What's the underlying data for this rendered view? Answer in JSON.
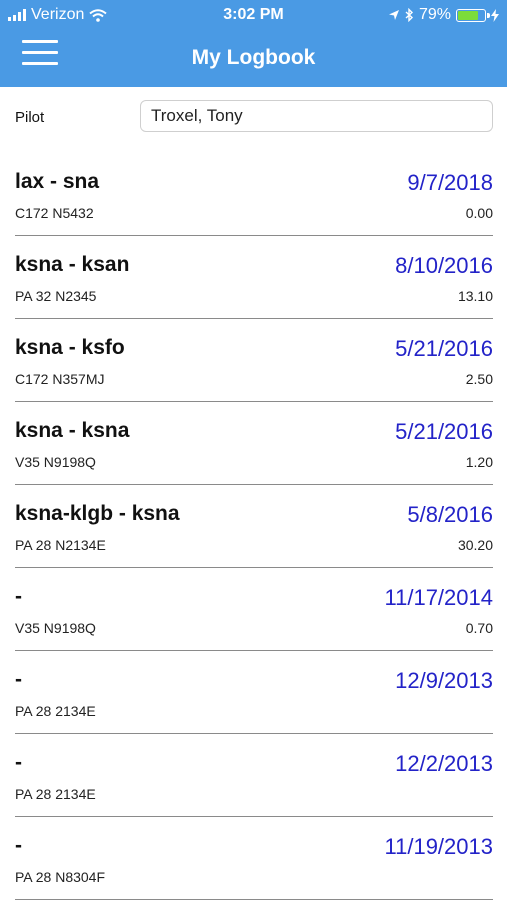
{
  "status_bar": {
    "carrier": "Verizon",
    "time": "3:02 PM",
    "battery": "79%",
    "battery_level": 0.79
  },
  "header": {
    "title": "My Logbook"
  },
  "pilot": {
    "label": "Pilot",
    "value": "Troxel, Tony"
  },
  "entries": [
    {
      "route": "lax - sna",
      "date": "9/7/2018",
      "aircraft": "C172 N5432",
      "hours": "0.00"
    },
    {
      "route": "ksna - ksan",
      "date": "8/10/2016",
      "aircraft": "PA 32 N2345",
      "hours": "13.10"
    },
    {
      "route": "ksna - ksfo",
      "date": "5/21/2016",
      "aircraft": "C172 N357MJ",
      "hours": "2.50"
    },
    {
      "route": "ksna - ksna",
      "date": "5/21/2016",
      "aircraft": "V35 N9198Q",
      "hours": "1.20"
    },
    {
      "route": "ksna-klgb - ksna",
      "date": "5/8/2016",
      "aircraft": "PA 28 N2134E",
      "hours": "30.20"
    },
    {
      "route": "-",
      "date": "11/17/2014",
      "aircraft": "V35 N9198Q",
      "hours": "0.70"
    },
    {
      "route": "-",
      "date": "12/9/2013",
      "aircraft": "PA 28 2134E",
      "hours": ""
    },
    {
      "route": "-",
      "date": "12/2/2013",
      "aircraft": "PA 28 2134E",
      "hours": ""
    },
    {
      "route": "-",
      "date": "11/19/2013",
      "aircraft": "PA 28 N8304F",
      "hours": ""
    }
  ]
}
